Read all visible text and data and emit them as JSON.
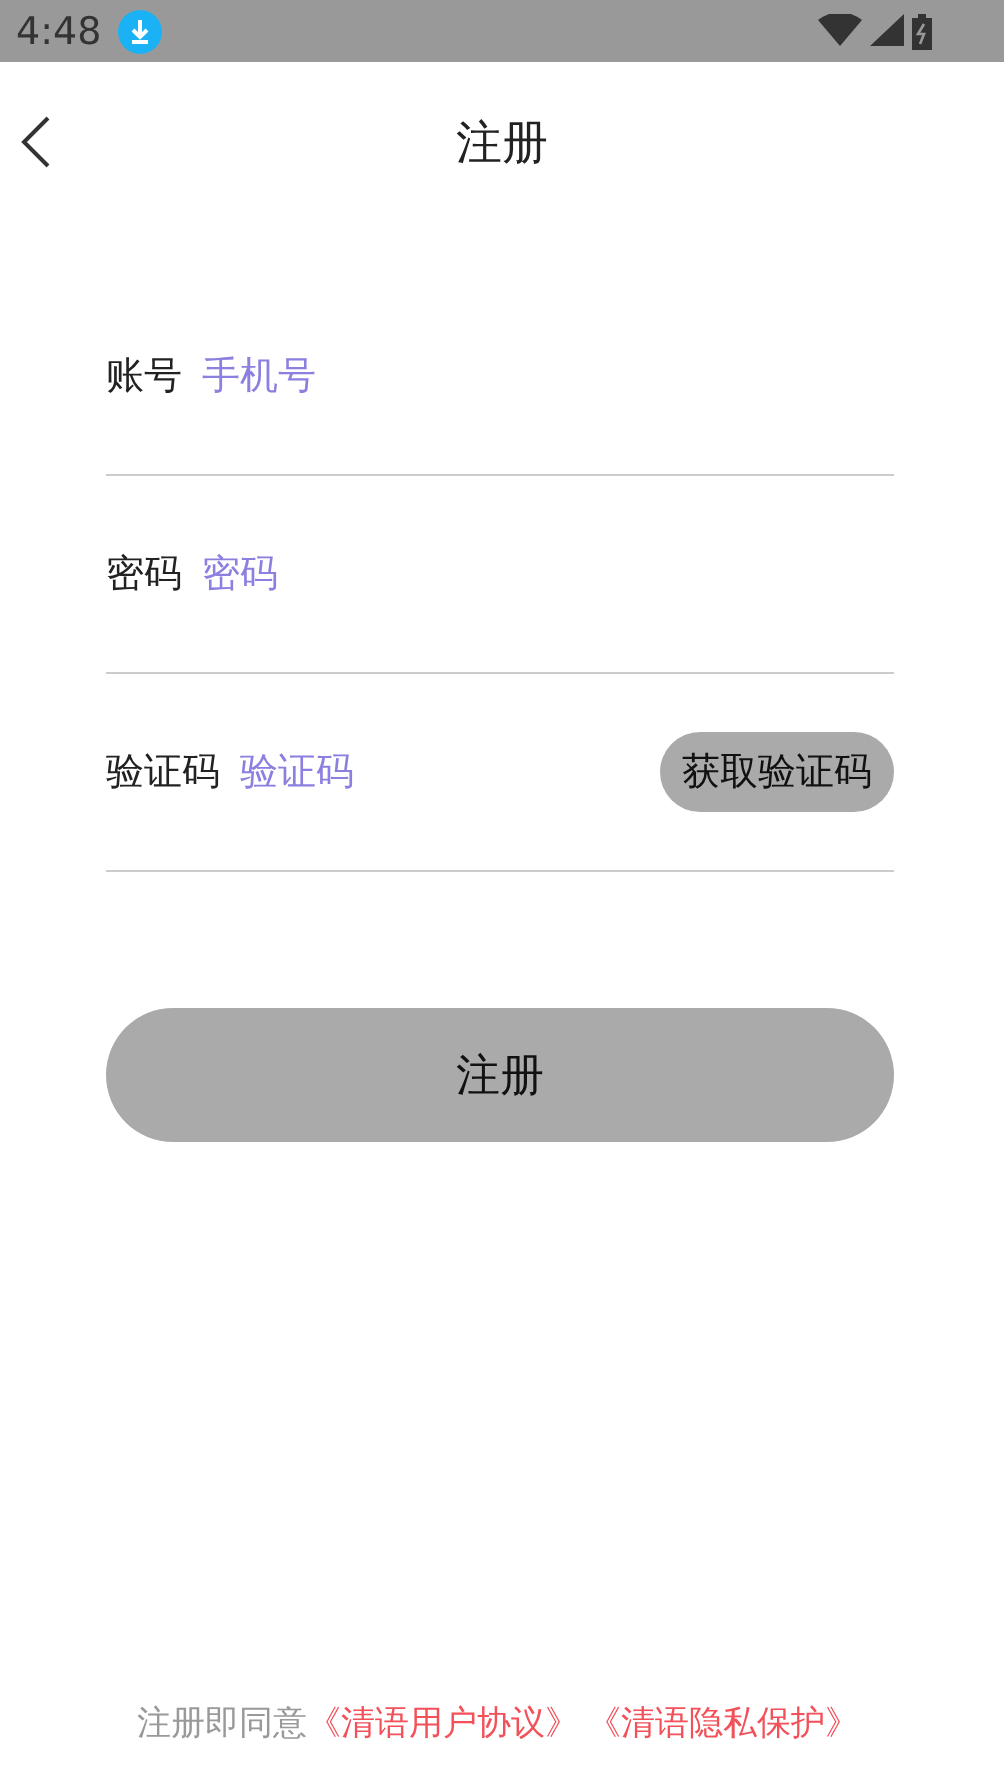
{
  "status_bar": {
    "time": "4:48"
  },
  "header": {
    "title": "注册"
  },
  "fields": [
    {
      "kind": "text",
      "label": "账号",
      "placeholder": "手机号"
    },
    {
      "kind": "text",
      "label": "密码",
      "placeholder": "密码"
    },
    {
      "kind": "code",
      "label": "验证码",
      "placeholder": "验证码",
      "action": "获取验证码"
    }
  ],
  "submit": "注册",
  "footer": {
    "text": "注册即同意",
    "links": [
      "《清语用户协议》",
      "《清语隐私保护》"
    ]
  }
}
